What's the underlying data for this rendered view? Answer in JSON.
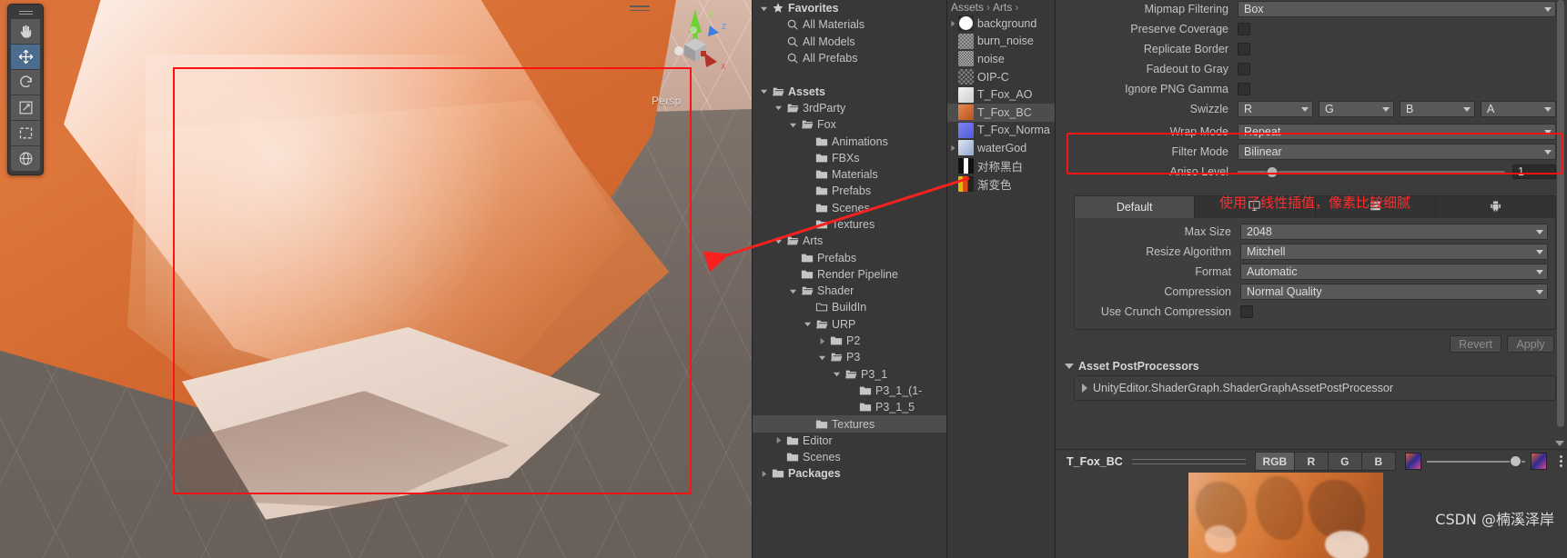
{
  "scene": {
    "perspective_label": "Persp",
    "gizmo_axes": [
      "x",
      "y",
      "z"
    ],
    "tools": [
      {
        "name": "hand-tool",
        "icon": "hand-icon",
        "active": false
      },
      {
        "name": "move-tool",
        "icon": "move-icon",
        "active": true
      },
      {
        "name": "rotate-tool",
        "icon": "rotate-icon",
        "active": false
      },
      {
        "name": "scale-tool",
        "icon": "scale-icon",
        "active": false
      },
      {
        "name": "rect-tool",
        "icon": "rect-icon",
        "active": false
      },
      {
        "name": "transform-tool",
        "icon": "transform-icon",
        "active": false
      }
    ]
  },
  "project": {
    "tree": [
      {
        "label": "Favorites",
        "depth": 0,
        "icon": "star-icon",
        "arrow": "down",
        "bold": true,
        "selected": false
      },
      {
        "label": "All Materials",
        "depth": 1,
        "icon": "search-icon",
        "arrow": "none",
        "bold": false,
        "selected": false
      },
      {
        "label": "All Models",
        "depth": 1,
        "icon": "search-icon",
        "arrow": "none",
        "bold": false,
        "selected": false
      },
      {
        "label": "All Prefabs",
        "depth": 1,
        "icon": "search-icon",
        "arrow": "none",
        "bold": false,
        "selected": false
      },
      {
        "label": "",
        "depth": 0,
        "icon": "none",
        "arrow": "none",
        "bold": false,
        "selected": false
      },
      {
        "label": "Assets",
        "depth": 0,
        "icon": "folder-open-icon",
        "arrow": "down",
        "bold": true,
        "selected": false
      },
      {
        "label": "3rdParty",
        "depth": 1,
        "icon": "folder-open-icon",
        "arrow": "down",
        "bold": false,
        "selected": false
      },
      {
        "label": "Fox",
        "depth": 2,
        "icon": "folder-open-icon",
        "arrow": "down",
        "bold": false,
        "selected": false
      },
      {
        "label": "Animations",
        "depth": 3,
        "icon": "folder-icon",
        "arrow": "none",
        "bold": false,
        "selected": false
      },
      {
        "label": "FBXs",
        "depth": 3,
        "icon": "folder-icon",
        "arrow": "none",
        "bold": false,
        "selected": false
      },
      {
        "label": "Materials",
        "depth": 3,
        "icon": "folder-icon",
        "arrow": "none",
        "bold": false,
        "selected": false
      },
      {
        "label": "Prefabs",
        "depth": 3,
        "icon": "folder-icon",
        "arrow": "none",
        "bold": false,
        "selected": false
      },
      {
        "label": "Scenes",
        "depth": 3,
        "icon": "folder-icon",
        "arrow": "none",
        "bold": false,
        "selected": false
      },
      {
        "label": "Textures",
        "depth": 3,
        "icon": "folder-icon",
        "arrow": "none",
        "bold": false,
        "selected": false
      },
      {
        "label": "Arts",
        "depth": 1,
        "icon": "folder-open-icon",
        "arrow": "down",
        "bold": false,
        "selected": false
      },
      {
        "label": "Prefabs",
        "depth": 2,
        "icon": "folder-icon",
        "arrow": "none",
        "bold": false,
        "selected": false
      },
      {
        "label": "Render Pipeline",
        "depth": 2,
        "icon": "folder-icon",
        "arrow": "none",
        "bold": false,
        "selected": false
      },
      {
        "label": "Shader",
        "depth": 2,
        "icon": "folder-open-icon",
        "arrow": "down",
        "bold": false,
        "selected": false
      },
      {
        "label": "BuildIn",
        "depth": 3,
        "icon": "folder-empty-icon",
        "arrow": "none",
        "bold": false,
        "selected": false
      },
      {
        "label": "URP",
        "depth": 3,
        "icon": "folder-open-icon",
        "arrow": "down",
        "bold": false,
        "selected": false
      },
      {
        "label": "P2",
        "depth": 4,
        "icon": "folder-icon",
        "arrow": "right",
        "bold": false,
        "selected": false
      },
      {
        "label": "P3",
        "depth": 4,
        "icon": "folder-open-icon",
        "arrow": "down",
        "bold": false,
        "selected": false
      },
      {
        "label": "P3_1",
        "depth": 5,
        "icon": "folder-open-icon",
        "arrow": "down",
        "bold": false,
        "selected": false
      },
      {
        "label": "P3_1_(1-",
        "depth": 6,
        "icon": "folder-icon",
        "arrow": "none",
        "bold": false,
        "selected": false
      },
      {
        "label": "P3_1_5",
        "depth": 6,
        "icon": "folder-icon",
        "arrow": "none",
        "bold": false,
        "selected": false
      },
      {
        "label": "Textures",
        "depth": 3,
        "icon": "folder-icon",
        "arrow": "none",
        "bold": false,
        "selected": true
      },
      {
        "label": "Editor",
        "depth": 1,
        "icon": "folder-icon",
        "arrow": "right",
        "bold": false,
        "selected": false
      },
      {
        "label": "Scenes",
        "depth": 1,
        "icon": "folder-icon",
        "arrow": "none",
        "bold": false,
        "selected": false
      },
      {
        "label": "Packages",
        "depth": 0,
        "icon": "folder-icon",
        "arrow": "right",
        "bold": true,
        "selected": false
      }
    ]
  },
  "assets": {
    "breadcrumb": [
      "Assets",
      "Arts",
      ""
    ],
    "items": [
      {
        "label": "background",
        "arrow": "right",
        "thumb": "white-circle",
        "selected": false
      },
      {
        "label": "burn_noise",
        "arrow": "none",
        "thumb": "noise-gray",
        "selected": false
      },
      {
        "label": "noise",
        "arrow": "none",
        "thumb": "noise-gray2",
        "selected": false
      },
      {
        "label": "OIP-C",
        "arrow": "none",
        "thumb": "noise-dark",
        "selected": false
      },
      {
        "label": "T_Fox_AO",
        "arrow": "none",
        "thumb": "ao-light",
        "selected": false
      },
      {
        "label": "T_Fox_BC",
        "arrow": "none",
        "thumb": "fox-orange",
        "selected": true
      },
      {
        "label": "T_Fox_Norma",
        "arrow": "none",
        "thumb": "normal-blue",
        "selected": false
      },
      {
        "label": "waterGod",
        "arrow": "right",
        "thumb": "character",
        "selected": false
      },
      {
        "label": "对称黑白",
        "arrow": "none",
        "thumb": "bw-gradient",
        "selected": false
      },
      {
        "label": "渐变色",
        "arrow": "none",
        "thumb": "color-gradient",
        "selected": false
      }
    ]
  },
  "inspector": {
    "top_rows": [
      {
        "label": "Mipmap Filtering",
        "type": "dropdown",
        "value": "Box"
      },
      {
        "label": "Preserve Coverage",
        "type": "checkbox",
        "value": false
      },
      {
        "label": "Replicate Border",
        "type": "checkbox",
        "value": false
      },
      {
        "label": "Fadeout to Gray",
        "type": "checkbox",
        "value": false
      },
      {
        "label": "Ignore PNG Gamma",
        "type": "checkbox",
        "value": false
      }
    ],
    "swizzle": {
      "label": "Swizzle",
      "values": [
        "R",
        "G",
        "B",
        "A"
      ]
    },
    "wrap_mode": {
      "label": "Wrap Mode",
      "value": "Repeat"
    },
    "filter_mode": {
      "label": "Filter Mode",
      "value": "Bilinear"
    },
    "aniso_level": {
      "label": "Aniso Level",
      "value": "1",
      "slider_percent": 13
    },
    "annotation_note": "使用了线性插值，像素比较细腻",
    "platform_tabs": [
      {
        "label": "Default",
        "icon": "text",
        "active": true
      },
      {
        "label": "",
        "icon": "monitor-icon",
        "active": false
      },
      {
        "label": "",
        "icon": "server-icon",
        "active": false
      },
      {
        "label": "",
        "icon": "android-icon",
        "active": false
      }
    ],
    "platform_rows": [
      {
        "label": "Max Size",
        "type": "dropdown",
        "value": "2048"
      },
      {
        "label": "Resize Algorithm",
        "type": "dropdown",
        "value": "Mitchell"
      },
      {
        "label": "Format",
        "type": "dropdown",
        "value": "Automatic"
      },
      {
        "label": "Compression",
        "type": "dropdown",
        "value": "Normal Quality"
      },
      {
        "label": "Use Crunch Compression",
        "type": "checkbox",
        "value": false
      }
    ],
    "buttons": {
      "revert": "Revert",
      "apply": "Apply"
    },
    "post_processors": {
      "title": "Asset PostProcessors",
      "items": [
        "UnityEditor.ShaderGraph.ShaderGraphAssetPostProcessor"
      ]
    },
    "preview": {
      "name": "T_Fox_BC",
      "channels": [
        "RGB",
        "R",
        "G",
        "B"
      ],
      "active_channel": "RGB"
    },
    "watermark": "CSDN @楠溪泽岸"
  },
  "colors": {
    "accent_red": "#fc1414",
    "panel_bg": "#3c3c3c",
    "tree_bg": "#383838",
    "selection": "#4d4d4d",
    "tool_active": "#4b6b8f"
  }
}
